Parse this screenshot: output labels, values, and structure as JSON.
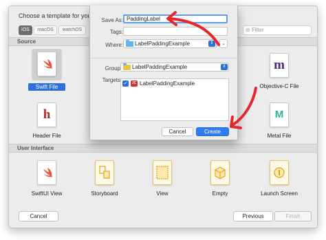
{
  "template_window": {
    "title": "Choose a template for your",
    "platform_tabs": [
      "iOS",
      "macOS",
      "watchOS"
    ],
    "filter_placeholder": "Filter",
    "sections": {
      "source": "Source",
      "user_interface": "User Interface"
    },
    "source_items": [
      {
        "label": "Swift File",
        "icon": "swift-file-icon",
        "selected": true
      },
      {
        "label": "Objective-C File",
        "icon": "objc-file-icon",
        "glyph": "m"
      },
      {
        "label": "Header File",
        "icon": "header-file-icon",
        "glyph": "h"
      },
      {
        "label": "Metal File",
        "icon": "metal-file-icon",
        "glyph": "M"
      }
    ],
    "ui_items": [
      {
        "label": "SwiftUI View",
        "icon": "swiftui-view-icon"
      },
      {
        "label": "Storyboard",
        "icon": "storyboard-icon"
      },
      {
        "label": "View",
        "icon": "view-icon"
      },
      {
        "label": "Empty",
        "icon": "empty-icon"
      },
      {
        "label": "Launch Screen",
        "icon": "launch-screen-icon"
      }
    ],
    "buttons": {
      "cancel": "Cancel",
      "previous": "Previous",
      "finish": "Finish"
    }
  },
  "save_sheet": {
    "save_as_label": "Save As:",
    "save_as_value": "PaddingLabel",
    "tags_label": "Tags:",
    "where_label": "Where:",
    "where_value": "LabelPaddingExample",
    "group_label": "Group",
    "group_value": "LabelPaddingExample",
    "targets_label": "Targets",
    "targets": [
      {
        "name": "LabelPaddingExample",
        "checked": true,
        "app_badge": "JC"
      }
    ],
    "buttons": {
      "cancel": "Cancel",
      "create": "Create"
    }
  },
  "colors": {
    "accent": "#2e7cf2",
    "annotation_arrow": "#e8262b",
    "swift_orange": "#f05138",
    "objc_purple": "#4a2a80",
    "header_red": "#b02828",
    "metal_teal": "#2bb89a"
  }
}
